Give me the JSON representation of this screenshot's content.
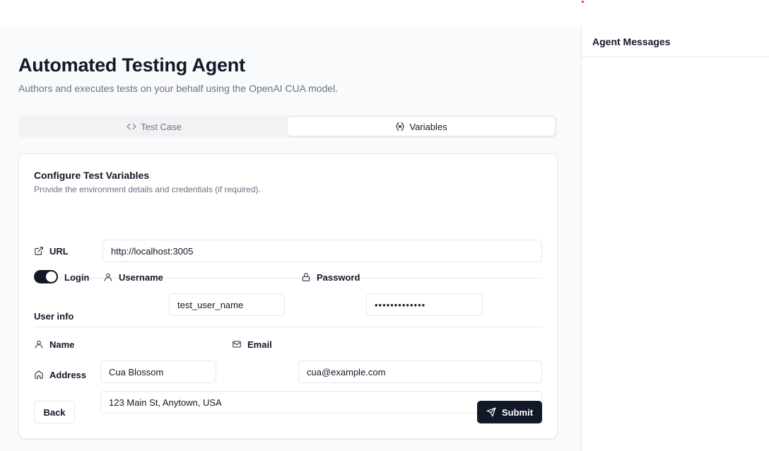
{
  "colors": {
    "accent": "#111827",
    "muted": "#6b7280",
    "border": "#e5e7eb"
  },
  "header": {
    "title": "Automated Testing Agent",
    "subtitle": "Authors and executes tests on your behalf using the OpenAI CUA model."
  },
  "tabs": [
    {
      "label": "Test Case",
      "icon": "code-icon",
      "active": false
    },
    {
      "label": "Variables",
      "icon": "variable-icon",
      "active": true
    }
  ],
  "card": {
    "title": "Configure Test Variables",
    "description": "Provide the environment details and credentials (if required)."
  },
  "fields": {
    "url": {
      "label": "URL",
      "icon": "external-link-icon",
      "value": "http://localhost:3005"
    },
    "login": {
      "label": "Login",
      "enabled": true
    },
    "username": {
      "label": "Username",
      "icon": "user-icon",
      "value": "test_user_name"
    },
    "password": {
      "label": "Password",
      "icon": "lock-icon",
      "value": "•••••••••••••"
    },
    "user_info_label": "User info",
    "name": {
      "label": "Name",
      "icon": "user-icon",
      "value": "Cua Blossom"
    },
    "email": {
      "label": "Email",
      "icon": "mail-icon",
      "value": "cua@example.com"
    },
    "address": {
      "label": "Address",
      "icon": "home-icon",
      "value": "123 Main St, Anytown, USA"
    }
  },
  "buttons": {
    "back": "Back",
    "submit": "Submit",
    "submit_icon": "send-icon"
  },
  "side_panel": {
    "title": "Agent Messages"
  }
}
